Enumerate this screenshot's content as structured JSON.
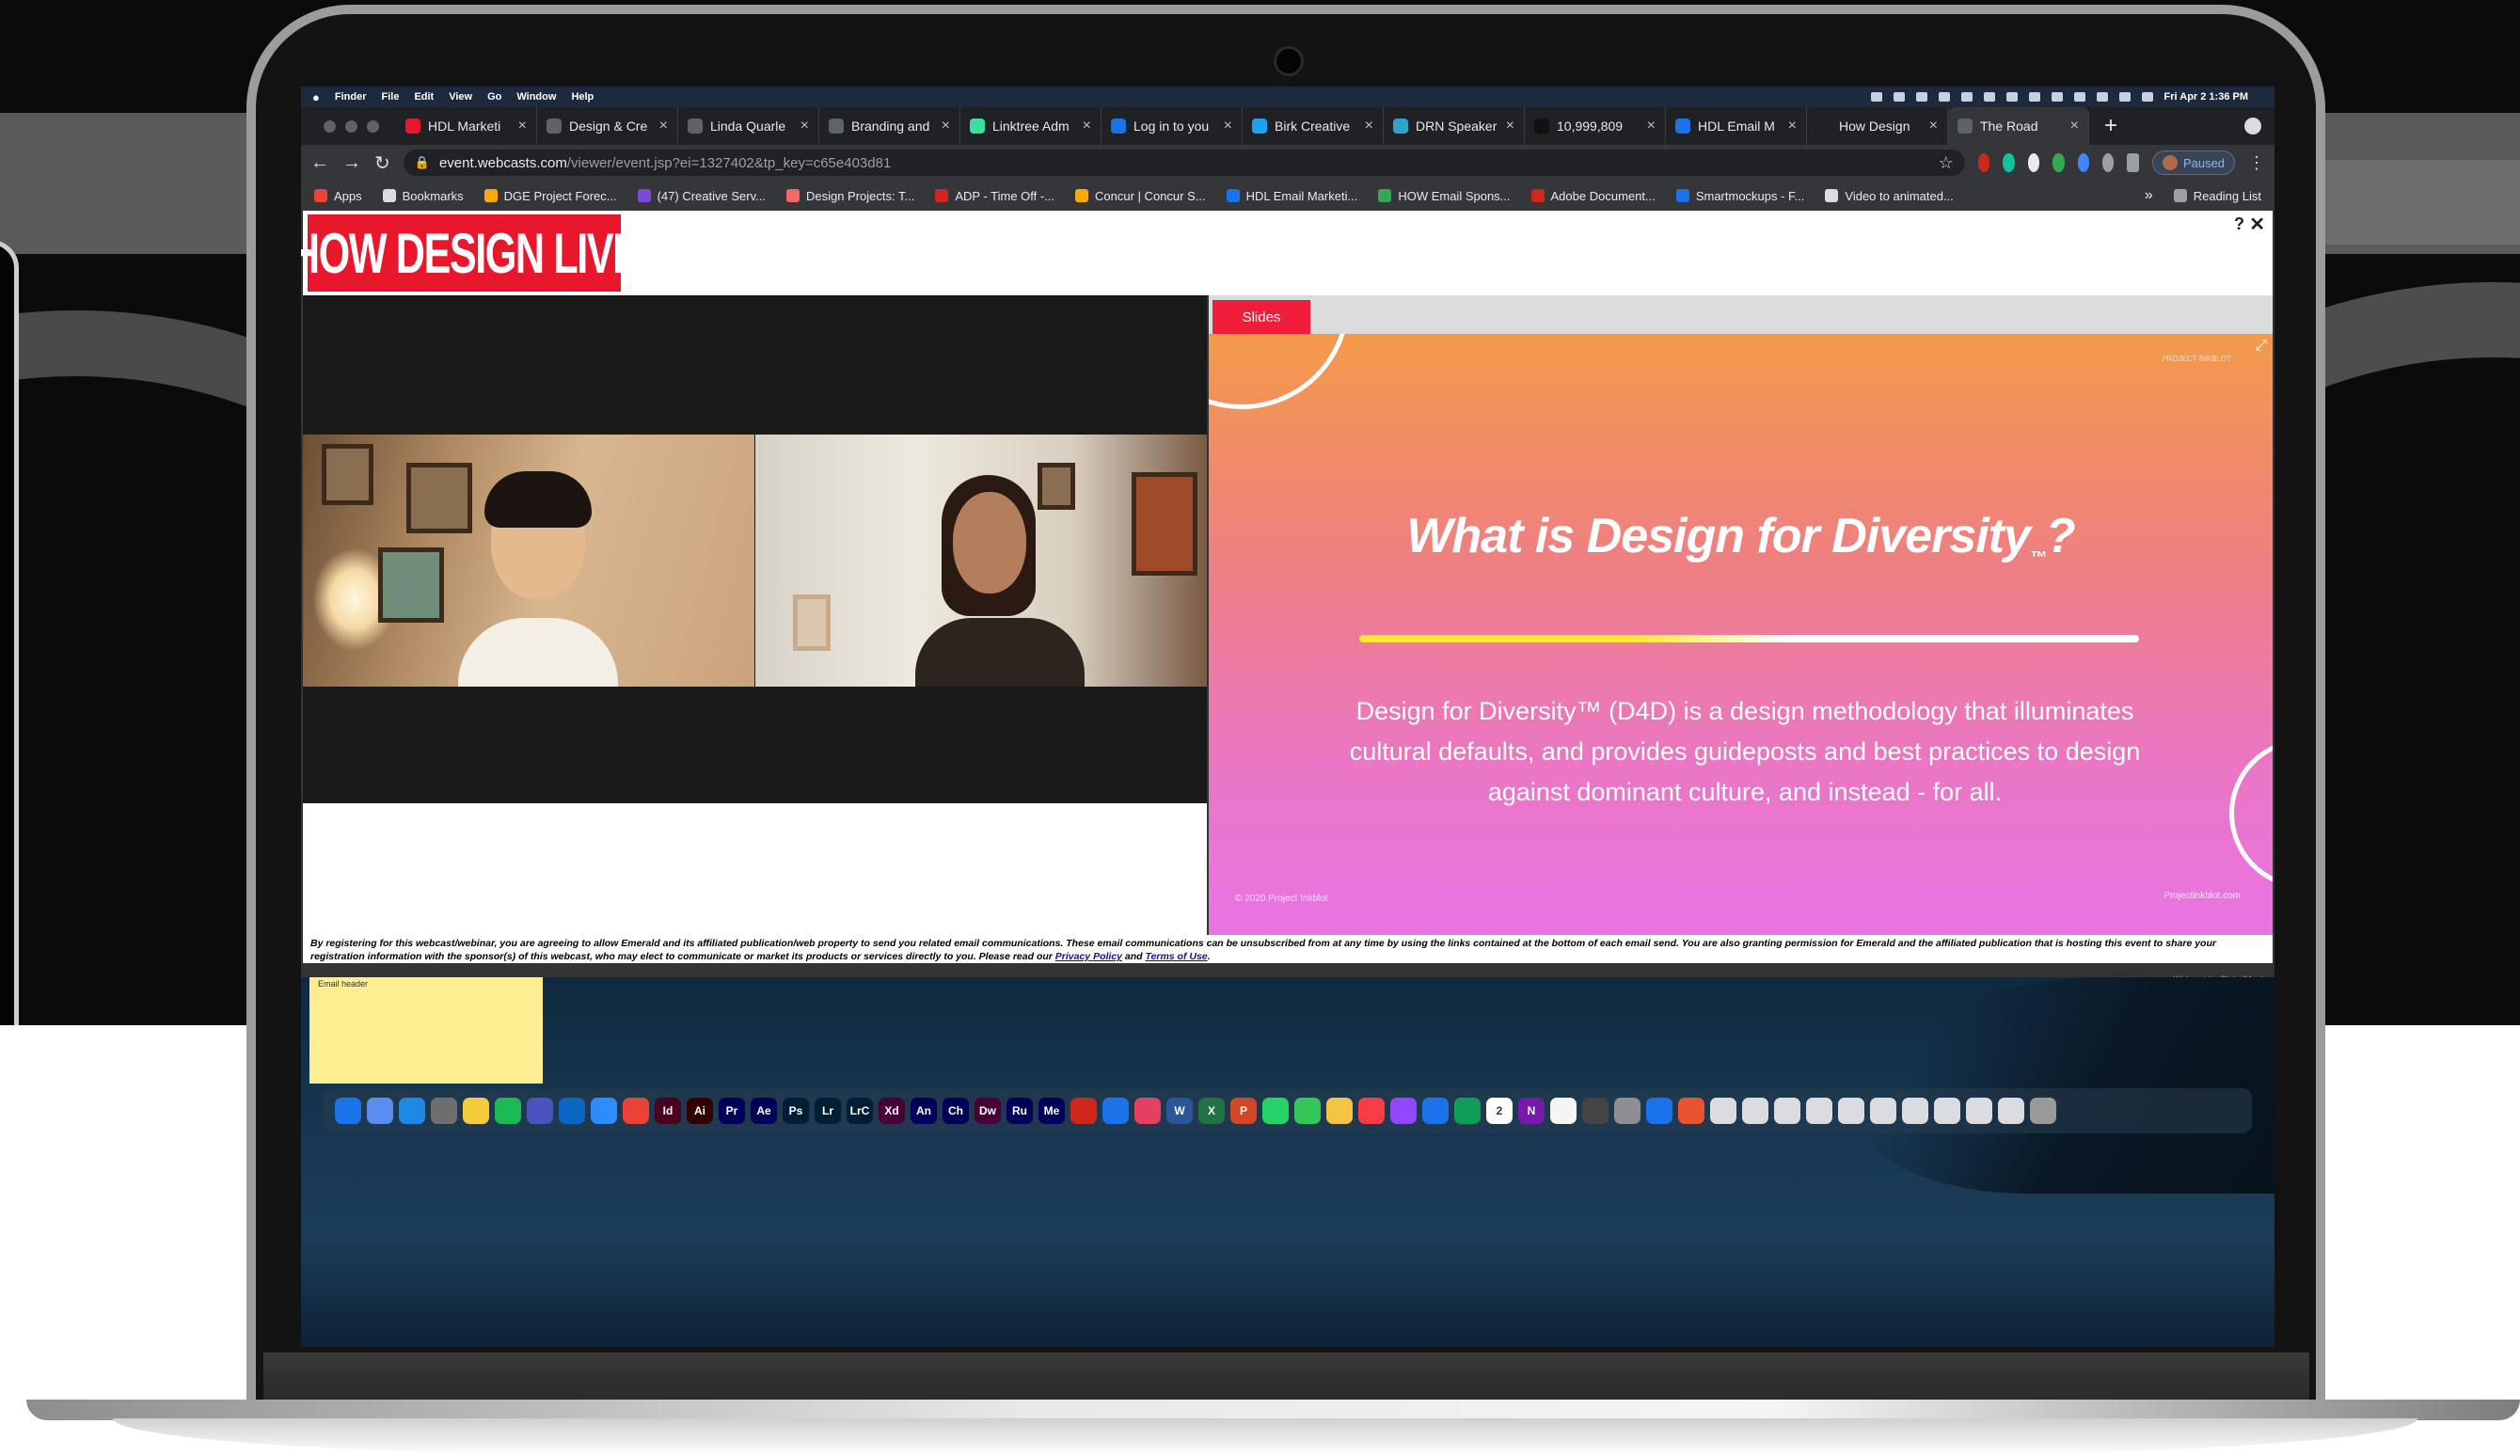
{
  "mac_menubar": {
    "apple": "",
    "items": [
      "Finder",
      "File",
      "Edit",
      "View",
      "Go",
      "Window",
      "Help"
    ],
    "clock": "Fri Apr 2  1:36 PM"
  },
  "browser": {
    "tabs": [
      {
        "label": "HDL Marketi",
        "icon_color": "#e9172b",
        "icon": "doc-icon"
      },
      {
        "label": "Design & Cre",
        "icon_color": "#5f6368",
        "icon": "globe-icon"
      },
      {
        "label": "Linda Quarle",
        "icon_color": "#5f6368",
        "icon": "globe-icon"
      },
      {
        "label": "Branding and",
        "icon_color": "#5f6368",
        "icon": "globe-icon"
      },
      {
        "label": "Linktree Adm",
        "icon_color": "#39e09b",
        "icon": "linktree-icon"
      },
      {
        "label": "Log in to you",
        "icon_color": "#1a73e8",
        "icon": "paypal-icon"
      },
      {
        "label": "Birk Creative",
        "icon_color": "#1da1f2",
        "icon": "twitter-icon"
      },
      {
        "label": "DRN Speaker",
        "icon_color": "#2aa5c9",
        "icon": "doc-icon"
      },
      {
        "label": "10,999,809",
        "icon_color": "#111111",
        "icon": "count-icon"
      },
      {
        "label": "HDL Email M",
        "icon_color": "#1a73e8",
        "icon": "doc-icon"
      },
      {
        "label": "How Design",
        "icon_color": "#202124",
        "icon": "globe-icon"
      },
      {
        "label": "The Road",
        "icon_color": "#5f6368",
        "icon": "globe-icon"
      }
    ],
    "new_tab_label": "+",
    "url_host": "event.webcasts.com",
    "url_path": "/viewer/event.jsp?ei=1327402&tp_key=c65e403d81",
    "profile_label": "Paused",
    "bookmarks": [
      {
        "label": "Apps",
        "color": "#ea4335"
      },
      {
        "label": "Bookmarks",
        "color": "#dadce0"
      },
      {
        "label": "DGE Project Forec...",
        "color": "#f9ab00"
      },
      {
        "label": "(47) Creative Serv...",
        "color": "#7b4bd6"
      },
      {
        "label": "Design Projects: T...",
        "color": "#f06a6a"
      },
      {
        "label": "ADP - Time Off -...",
        "color": "#d0271d"
      },
      {
        "label": "Concur | Concur S...",
        "color": "#f9ab00"
      },
      {
        "label": "HDL Email Marketi...",
        "color": "#1a73e8"
      },
      {
        "label": "HOW Email Spons...",
        "color": "#34a853"
      },
      {
        "label": "Adobe Document...",
        "color": "#d0271d"
      },
      {
        "label": "Smartmockups - F...",
        "color": "#1a73e8"
      },
      {
        "label": "Video to animated...",
        "color": "#dadce0"
      }
    ],
    "bookmarks_more": "»",
    "reading_list": "Reading List"
  },
  "event": {
    "logo_text": "HOW DESIGN LIVE",
    "help_label": "?",
    "close_label": "✕",
    "slides_tab": "Slides",
    "slide": {
      "title": "What is Design for Diversity",
      "title_tm": "™",
      "title_q": "?",
      "body": "Design for Diversity™ (D4D) is a design methodology that illuminates cultural defaults, and provides guideposts and best practices to design against dominant culture, and instead - for all.",
      "copyright": "© 2020 Project Inkblot",
      "url": "Projectinkblot.com",
      "brand_tr": "PROJECT INKBLOT"
    },
    "disclaimer": "By registering for this webcast/webinar, you are agreeing to allow Emerald and its affiliated publication/web property to send you related email communications. These email communications can be unsubscribed from at any time by using the links contained at the bottom of each email send. You are also granting permission for Emerald and the affiliated publication that is hosting this event to share your registration information with the sponsor(s) of this webcast, who may elect to communicate or market its products or services directly to you. Please read our",
    "privacy_link": "Privacy Policy",
    "and_text": "and",
    "terms_link": "Terms of Use",
    "period": ".",
    "webcast_by": "Webcast by  GlobalMeet"
  },
  "desktop": {
    "sticky_title": "Email header",
    "dock_apps": [
      {
        "label": "",
        "color": "#1a73e8"
      },
      {
        "label": "",
        "color": "#5b8def"
      },
      {
        "label": "",
        "color": "#1e88e5"
      },
      {
        "label": "",
        "color": "#6e6e6e"
      },
      {
        "label": "",
        "color": "#f5cc3a"
      },
      {
        "label": "",
        "color": "#1db954"
      },
      {
        "label": "",
        "color": "#4b53bc"
      },
      {
        "label": "",
        "color": "#0a66c2"
      },
      {
        "label": "",
        "color": "#2d8cff"
      },
      {
        "label": "",
        "color": "#ea4335"
      },
      {
        "label": "Id",
        "color": "#49021f"
      },
      {
        "label": "Ai",
        "color": "#330000"
      },
      {
        "label": "Pr",
        "color": "#00005b"
      },
      {
        "label": "Ae",
        "color": "#00005b"
      },
      {
        "label": "Ps",
        "color": "#001e36"
      },
      {
        "label": "Lr",
        "color": "#001e36"
      },
      {
        "label": "LrC",
        "color": "#001e36"
      },
      {
        "label": "Xd",
        "color": "#470137"
      },
      {
        "label": "An",
        "color": "#00005b"
      },
      {
        "label": "Ch",
        "color": "#00005b"
      },
      {
        "label": "Dw",
        "color": "#470137"
      },
      {
        "label": "Ru",
        "color": "#00005b"
      },
      {
        "label": "Me",
        "color": "#00005b"
      },
      {
        "label": "",
        "color": "#d0271d"
      },
      {
        "label": "",
        "color": "#1a73e8"
      },
      {
        "label": "",
        "color": "#e4405f"
      },
      {
        "label": "W",
        "color": "#2b579a"
      },
      {
        "label": "X",
        "color": "#217346"
      },
      {
        "label": "P",
        "color": "#d24726"
      },
      {
        "label": "",
        "color": "#25d366"
      },
      {
        "label": "",
        "color": "#34c759"
      },
      {
        "label": "",
        "color": "#f4c542"
      },
      {
        "label": "",
        "color": "#fc3c44"
      },
      {
        "label": "",
        "color": "#9146ff"
      },
      {
        "label": "",
        "color": "#1a73e8"
      },
      {
        "label": "",
        "color": "#0f9d58"
      },
      {
        "label": "2",
        "color": "#ffffff"
      },
      {
        "label": "N",
        "color": "#7719aa"
      },
      {
        "label": "",
        "color": "#f5f5f5"
      },
      {
        "label": "",
        "color": "#444444"
      },
      {
        "label": "",
        "color": "#8e8e93"
      },
      {
        "label": "",
        "color": "#1a73e8"
      },
      {
        "label": "",
        "color": "#e8542f"
      },
      {
        "label": "",
        "color": "#dadce0"
      },
      {
        "label": "",
        "color": "#dadce0"
      },
      {
        "label": "",
        "color": "#dadce0"
      },
      {
        "label": "",
        "color": "#dadce0"
      },
      {
        "label": "",
        "color": "#dadce0"
      },
      {
        "label": "",
        "color": "#dadce0"
      },
      {
        "label": "",
        "color": "#dadce0"
      },
      {
        "label": "",
        "color": "#dadce0"
      },
      {
        "label": "",
        "color": "#dadce0"
      },
      {
        "label": "",
        "color": "#dadce0"
      },
      {
        "label": "",
        "color": "#9a9a9a"
      }
    ]
  }
}
